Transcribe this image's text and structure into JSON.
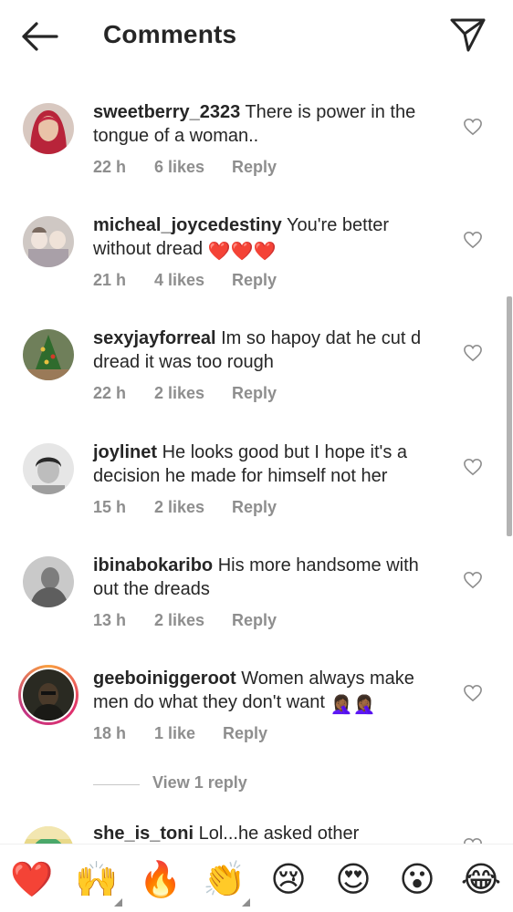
{
  "header": {
    "title": "Comments",
    "back_icon": "arrow-left-icon",
    "send_icon": "paper-plane-icon"
  },
  "comments": [
    {
      "username": "sweetberry_2323",
      "text": "There is power in the tongue of a woman..",
      "time": "22 h",
      "likes": "6 likes",
      "reply": "Reply"
    },
    {
      "username": "micheal_joycedestiny",
      "text": "You're better without  dread",
      "emoji": "❤️❤️❤️",
      "time": "21 h",
      "likes": "4 likes",
      "reply": "Reply"
    },
    {
      "username": "sexyjayforreal",
      "text": "Im so hapoy dat he cut d dread it was too rough",
      "time": "22 h",
      "likes": "2 likes",
      "reply": "Reply"
    },
    {
      "username": "joylinet",
      "text": "He looks good but I hope it's a decision he made for himself not her",
      "time": "15 h",
      "likes": "2 likes",
      "reply": "Reply"
    },
    {
      "username": "ibinabokaribo",
      "text": "His more handsome with out the dreads",
      "time": "13 h",
      "likes": "2 likes",
      "reply": "Reply"
    },
    {
      "username": "geeboiniggeroot",
      "text": "Women always make men do what they don't want",
      "emoji": "🤦🏾‍♀️🤦🏾‍♀️",
      "time": "18 h",
      "likes": "1 like",
      "reply": "Reply",
      "view_replies": "View 1 reply"
    },
    {
      "username": "she_is_toni",
      "text": "Lol...he asked other"
    }
  ],
  "emoji_bar": [
    "❤️",
    "🙌",
    "🔥",
    "👏",
    "😢",
    "😍",
    "😮",
    "😂"
  ],
  "colors": {
    "text": "#262626",
    "secondary": "#8e8e8e",
    "story_ring_start": "#f9a03f",
    "story_ring_end": "#c13584"
  }
}
